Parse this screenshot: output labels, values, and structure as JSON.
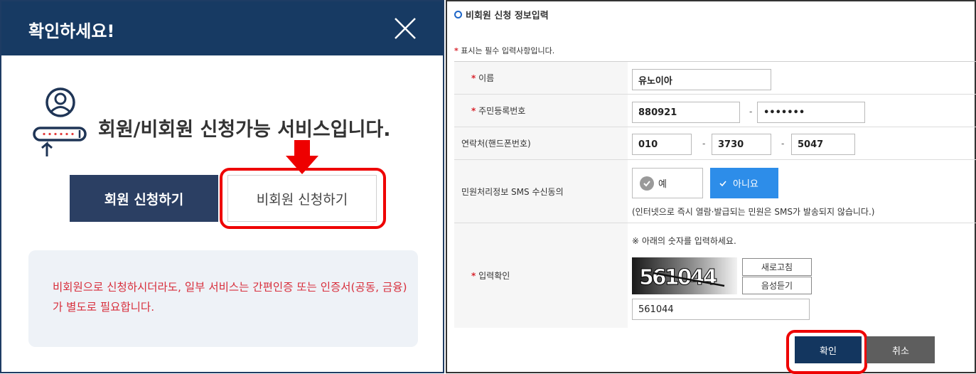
{
  "modal": {
    "title": "확인하세요!",
    "headline": "회원/비회원 신청가능 서비스입니다.",
    "member_button": "회원 신청하기",
    "nonmember_button": "비회원 신청하기",
    "notice": "비회원으로 신청하시더라도, 일부 서비스는 간편인증 또는 인증서(공동, 금융)가 별도로 필요합니다."
  },
  "form": {
    "title": "비회원 신청 정보입력",
    "required_star": "*",
    "required_note": "표시는 필수 입력사항입니다.",
    "name_label": "이름",
    "name_value": "유노이아",
    "rrn_label": "주민등록번호",
    "rrn_front": "880921",
    "rrn_back": "•••••••",
    "phone_label": "연락처(핸드폰번호)",
    "phone": [
      "010",
      "3730",
      "5047"
    ],
    "sms_label": "민원처리정보 SMS 수신동의",
    "sms_yes": "예",
    "sms_no": "아니요",
    "sms_note": "(인터넷으로 즉시 열람·발급되는 민원은 SMS가 발송되지 않습니다.)",
    "captcha_label": "입력확인",
    "captcha_note": "※ 아래의 숫자를 입력하세요.",
    "captcha_image_text": "561044",
    "refresh_button": "새로고침",
    "audio_button": "음성듣기",
    "captcha_value": "561044",
    "confirm_button": "확인",
    "cancel_button": "취소"
  },
  "colors": {
    "header_navy": "#173a63",
    "highlight_red": "#e00000",
    "sms_selected_blue": "#2d8de9",
    "notice_red": "#d82f3c"
  }
}
